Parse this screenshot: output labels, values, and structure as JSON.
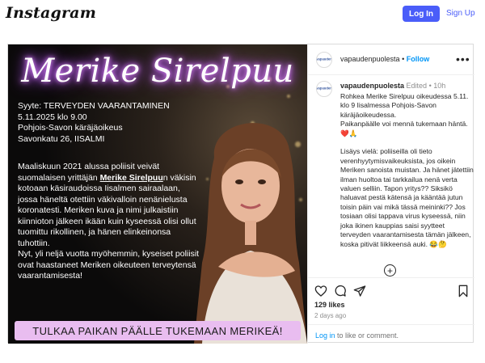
{
  "header": {
    "logo_text": "Instagram",
    "login_label": "Log In",
    "signup_label": "Sign Up"
  },
  "post": {
    "username": "vapaudenpuolesta",
    "separator": "•",
    "follow_label": "Follow",
    "more_label": "•••",
    "avatar_text": "vapauden",
    "image": {
      "headline": "Merike Sirelpuu",
      "info_lines": [
        "Syyte: TERVEYDEN VAARANTAMINEN",
        "5.11.2025 klo 9.00",
        "Pohjois-Savon käräjäoikeus",
        "Savonkatu 26, IISALMI"
      ],
      "story_before": "Maaliskuun 2021 alussa poliisit veivät suomalaisen yrittäjän ",
      "story_name": "Merike Sirelpuu",
      "story_after": "n väkisin kotoaan käsiraudoissa Iisalmen sairaalaan, jossa häneltä otettiin väkivalloin nenänielusta koronatesti. Meriken kuva ja nimi julkaistiin kiinnioton jälkeen ikään kuin kyseessä olisi ollut tuomittu rikollinen, ja hänen elinkeinonsa tuhottiin.\nNyt, yli neljä vuotta myöhemmin, kyseiset poliisit ovat haastaneet Meriken oikeuteen terveytensä vaarantamisesta!",
      "banner": "TULKAA PAIKAN PÄÄLLE TUKEMAAN MERIKEÄ!"
    },
    "caption": {
      "username": "vapaudenpuolesta",
      "edited": "Edited",
      "age": "10h",
      "text": "Rohkea Merike Sirelpuu oikeudessa 5.11. klo 9 Iisalmessa Pohjois-Savon käräjäoikeudessa.\nPaikanpäälle voi mennä tukemaan häntä. ❤️🙏\n\nLisäys vielä: poliiseilla oli tieto verenhyytymisvaikeuksista, jos oikein Meriken sanoista muistan. Ja hänet jätettiin ilman huoltoa tai tarkkailua nenä verta valuen selliin. Tapon yritys?? Siksikö haluavat pestä kätensä ja kääntää jutun toisin päin vai mikä tässä meininki?? Jos tosiaan olisi tappava virus kyseessä, niin joka ikinen kauppias saisi syytteet terveyden vaarantamisesta tämän jälkeen, koska pitivät liikkeensä auki. 😂🤔"
    },
    "plus_label": "+",
    "likes": "129 likes",
    "time_ago": "2 days ago",
    "login_prompt": {
      "link": "Log in",
      "rest": " to like or comment."
    }
  },
  "colors": {
    "accent": "#4a5df9",
    "link": "#0095f6",
    "banner": "#e9bdf0",
    "heart": "#ed4956"
  }
}
